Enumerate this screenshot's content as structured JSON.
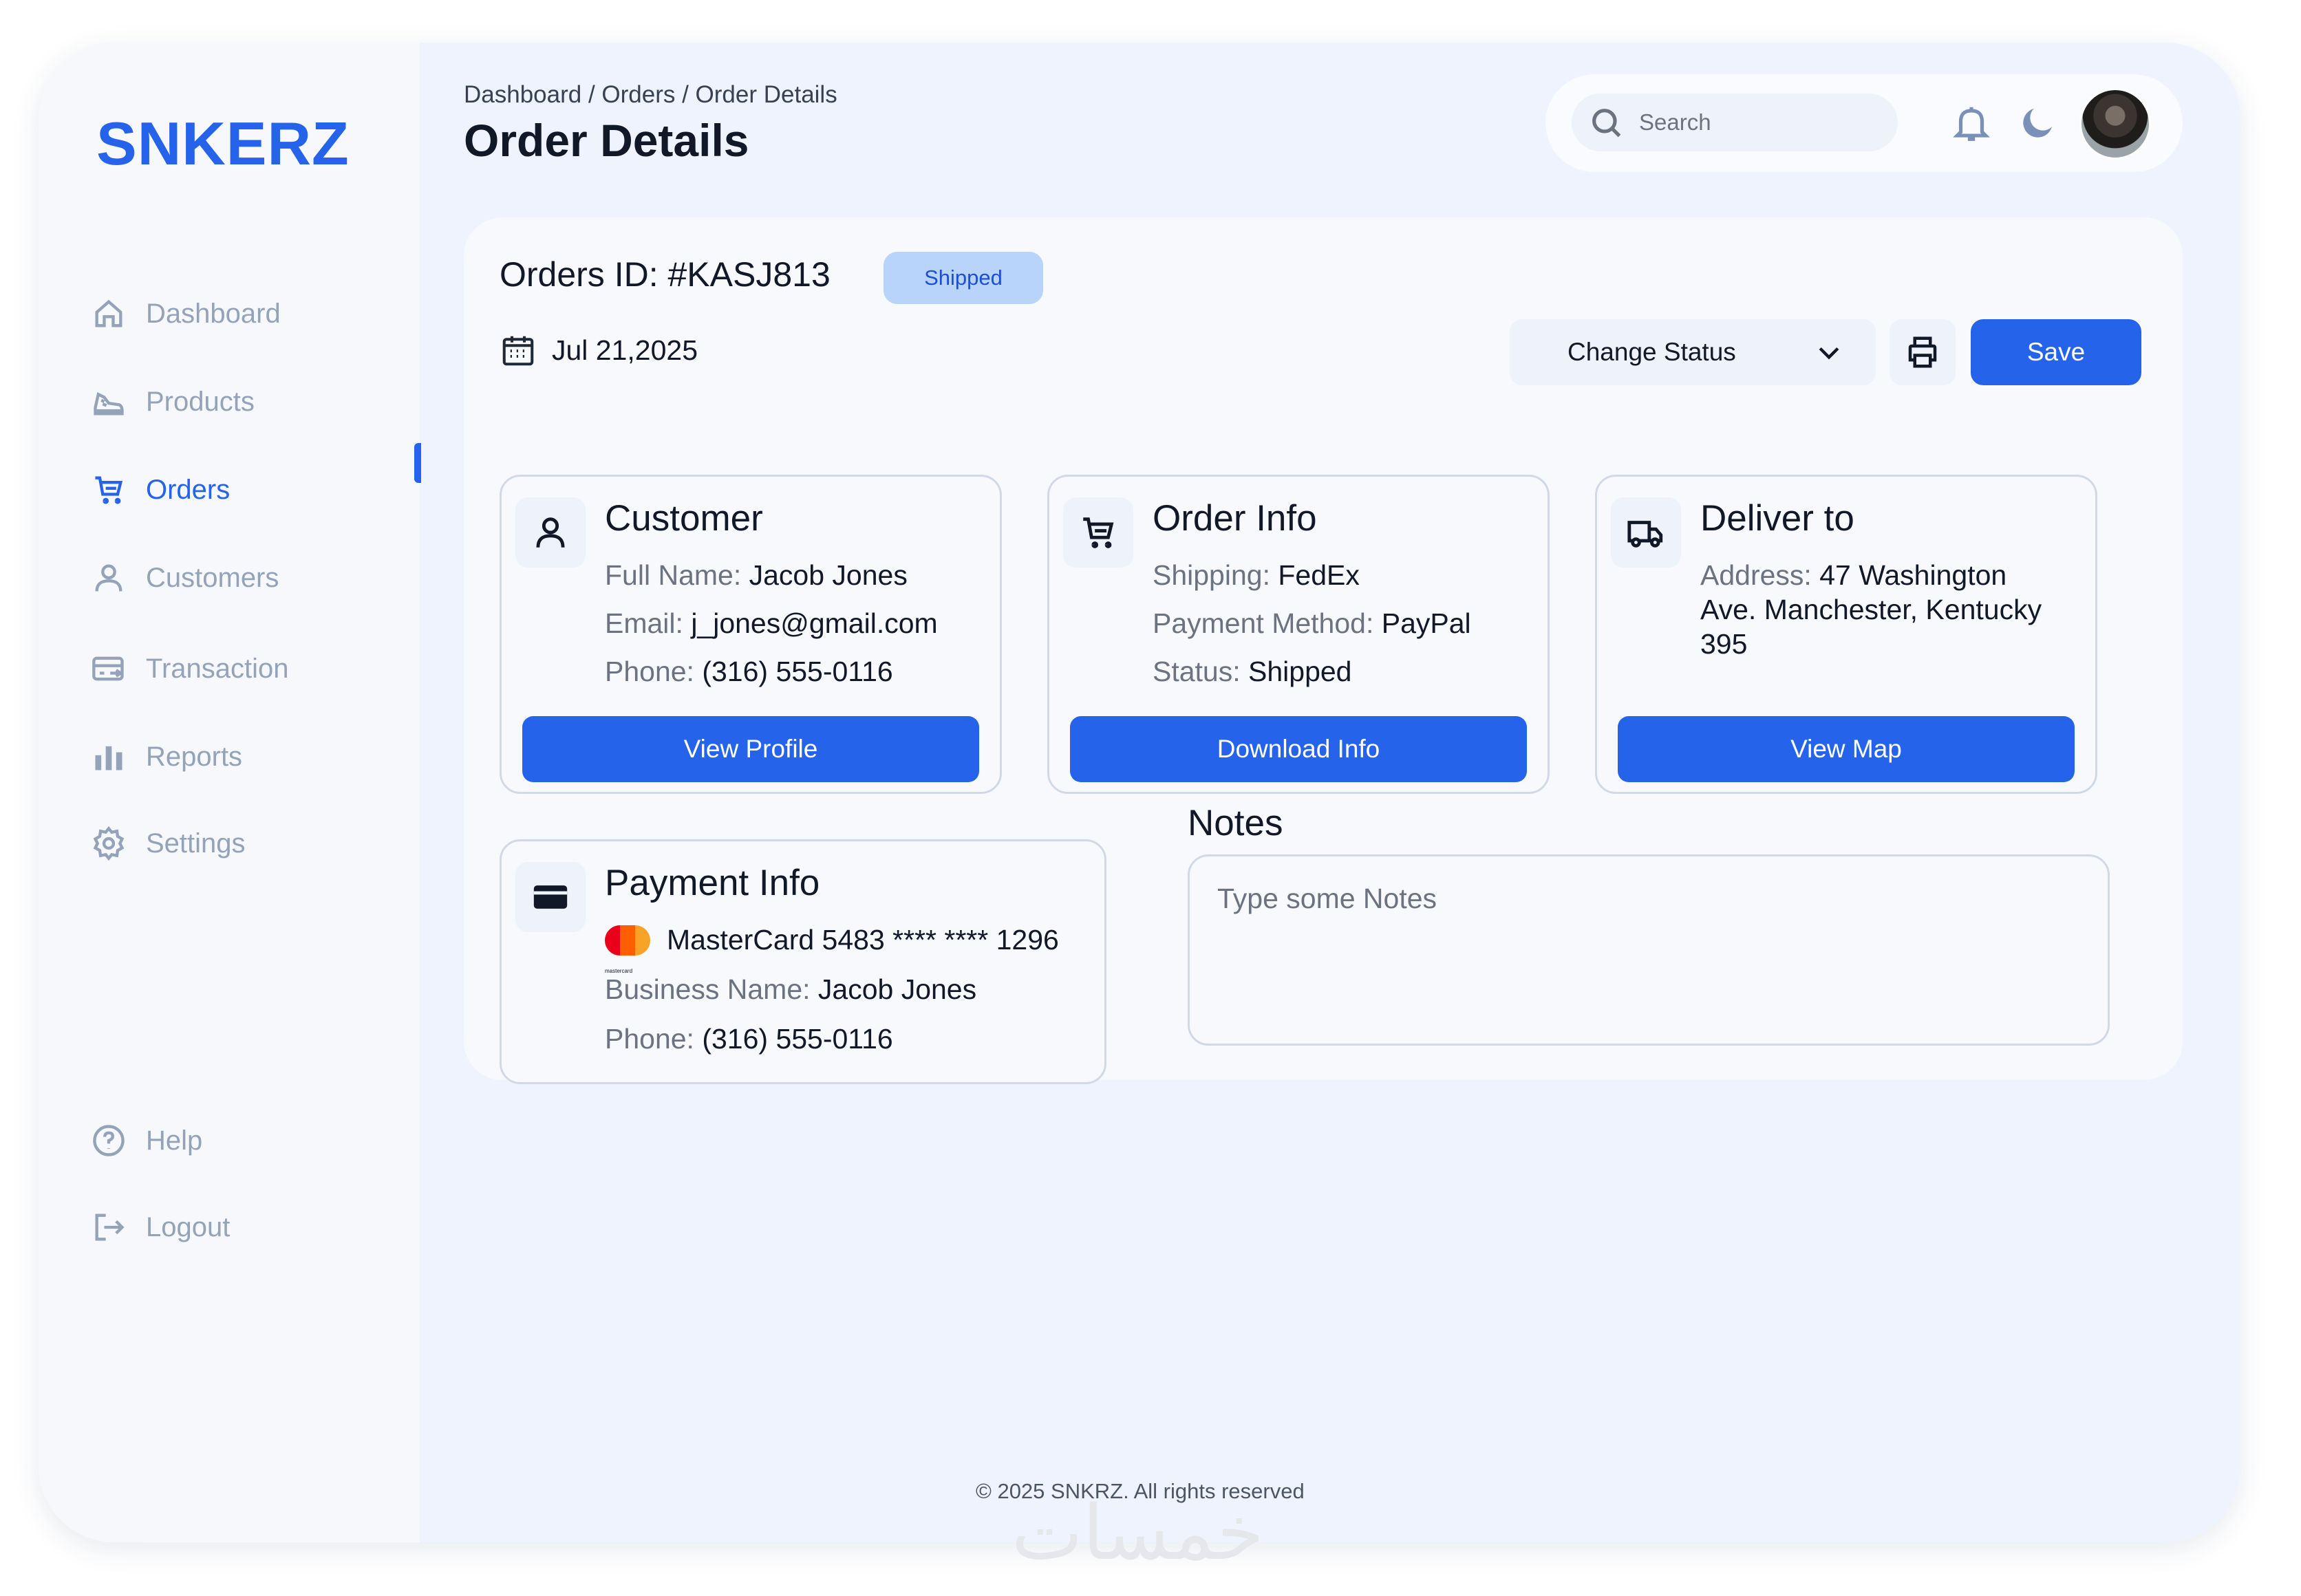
{
  "brand": {
    "name": "SNKERZ",
    "accent": "#2563eb"
  },
  "sidebar": {
    "items": [
      {
        "label": "Dashboard",
        "icon": "home-icon"
      },
      {
        "label": "Products",
        "icon": "sneaker-icon"
      },
      {
        "label": "Orders",
        "icon": "cart-icon",
        "active": true
      },
      {
        "label": "Customers",
        "icon": "user-icon"
      },
      {
        "label": "Transaction",
        "icon": "transaction-icon"
      },
      {
        "label": "Reports",
        "icon": "bar-chart-icon"
      },
      {
        "label": "Settings",
        "icon": "gear-icon"
      }
    ],
    "bottom": [
      {
        "label": "Help",
        "icon": "help-icon"
      },
      {
        "label": "Logout",
        "icon": "logout-icon"
      }
    ]
  },
  "header": {
    "breadcrumb": "Dashboard / Orders / Order Details",
    "title": "Order Details",
    "search_placeholder": "Search"
  },
  "order": {
    "id_label": "Orders ID: #KASJ813",
    "status_badge": "Shipped",
    "date": "Jul 21,2025",
    "change_status_label": "Change Status",
    "save_label": "Save"
  },
  "customer": {
    "title": "Customer",
    "full_name_label": "Full Name: ",
    "full_name": "Jacob Jones",
    "email_label": "Email: ",
    "email": "j_jones@gmail.com",
    "phone_label": "Phone: ",
    "phone": "(316) 555-0116",
    "button": "View Profile"
  },
  "order_info": {
    "title": "Order Info",
    "shipping_label": "Shipping: ",
    "shipping": "FedEx",
    "payment_label": "Payment Method: ",
    "payment": "PayPal",
    "status_label": "Status: ",
    "status": "Shipped",
    "button": "Download Info"
  },
  "deliver": {
    "title": "Deliver to",
    "address_label": "Address: ",
    "address_line1": "47 Washington",
    "address_line2": "Ave. Manchester, Kentucky",
    "address_line3": "395",
    "button": "View Map"
  },
  "payment": {
    "title": "Payment Info",
    "card": "MasterCard 5483 **** **** 1296",
    "card_brand_mark": "mastercard",
    "business_label": "Business Name: ",
    "business": "Jacob Jones",
    "phone_label": "Phone: ",
    "phone": "(316) 555-0116"
  },
  "notes": {
    "title": "Notes",
    "placeholder": "Type some Notes"
  },
  "footer": {
    "text": "© 2025 SNKRZ. All rights reserved"
  },
  "watermark": {
    "text": "خمسات"
  }
}
